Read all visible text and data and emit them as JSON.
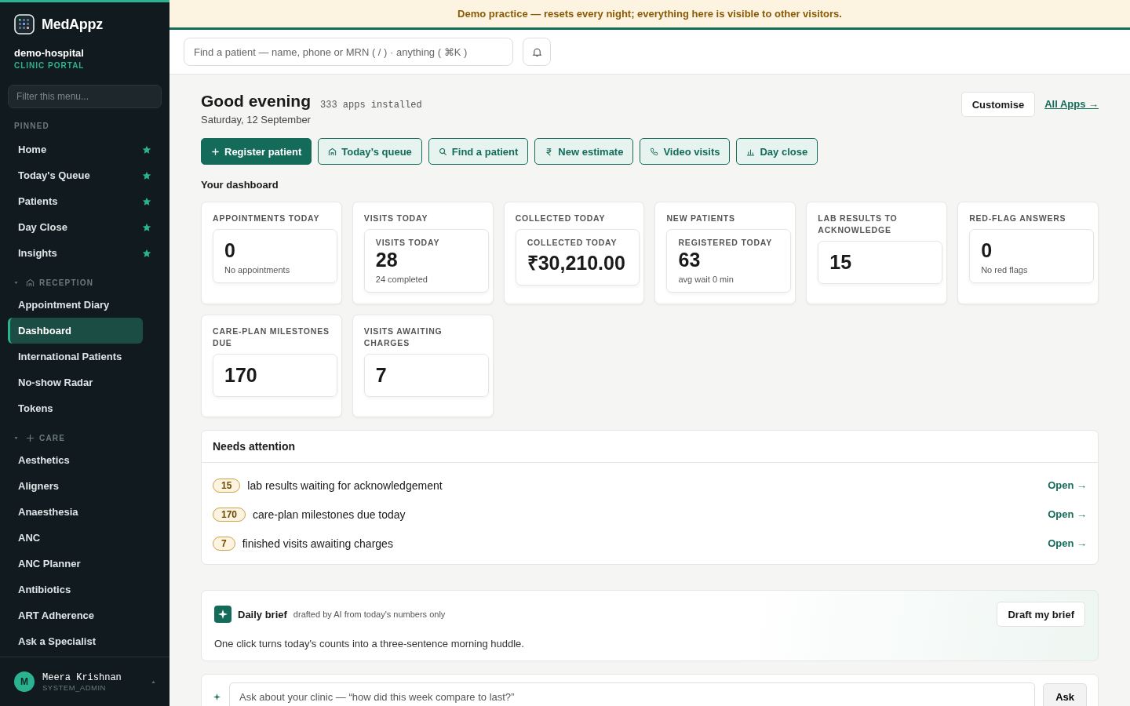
{
  "brand": {
    "name": "MedAppz",
    "org": "demo-hospital",
    "portal": "CLINIC PORTAL"
  },
  "sidebar": {
    "filter": {
      "placeholder": "Filter this menu..."
    },
    "pinned": {
      "title": "PINNED",
      "items": [
        {
          "label": "Home",
          "starred": true
        },
        {
          "label": "Today's Queue",
          "starred": true
        },
        {
          "label": "Patients",
          "starred": true
        },
        {
          "label": "Day Close",
          "starred": true
        },
        {
          "label": "Insights",
          "starred": true
        }
      ]
    },
    "sections": [
      {
        "title": "RECEPTION",
        "expanded": true,
        "items": [
          {
            "label": "Appointment Diary",
            "selected": false
          },
          {
            "label": "Dashboard",
            "selected": true
          },
          {
            "label": "International Patients",
            "selected": false
          },
          {
            "label": "No-show Radar",
            "selected": false
          },
          {
            "label": "Tokens",
            "selected": false
          }
        ]
      },
      {
        "title": "CARE",
        "expanded": true,
        "items": [
          {
            "label": "Aesthetics",
            "selected": false
          },
          {
            "label": "Aligners",
            "selected": false
          },
          {
            "label": "Anaesthesia",
            "selected": false
          },
          {
            "label": "ANC",
            "selected": false
          },
          {
            "label": "ANC Planner",
            "selected": false
          },
          {
            "label": "Antibiotics",
            "selected": false
          },
          {
            "label": "ART Adherence",
            "selected": false
          },
          {
            "label": "Ask a Specialist",
            "selected": false
          }
        ]
      }
    ],
    "user": {
      "initial": "M",
      "name": "Meera Krishnan",
      "role": "SYSTEM_ADMIN"
    }
  },
  "banner": "Demo practice — resets every night; everything here is visible to other visitors.",
  "search": {
    "placeholder": "Find a patient — name, phone or MRN ( / ) · anything ( ⌘K )"
  },
  "header": {
    "greeting": "Good evening",
    "date": "Saturday, 12 September",
    "apps": "333 apps installed",
    "customise": "Customise",
    "all_apps": "All Apps →"
  },
  "actions": [
    {
      "label": "Register patient",
      "kind": "primary"
    },
    {
      "label": "Today’s queue",
      "kind": "outline"
    },
    {
      "label": "Find a patient",
      "kind": "outline"
    },
    {
      "label": "New estimate",
      "kind": "outline"
    },
    {
      "label": "Video visits",
      "kind": "outline"
    },
    {
      "label": "Day close",
      "kind": "outline"
    }
  ],
  "dashboard": {
    "title": "Your dashboard",
    "widgets": [
      {
        "title": "APPOINTMENTS TODAY",
        "value": "0",
        "sub": "No appointments"
      },
      {
        "title": "VISITS TODAY",
        "label": "VISITS TODAY",
        "value": "28",
        "sub": "24 completed"
      },
      {
        "title": "COLLECTED TODAY",
        "label": "COLLECTED TODAY",
        "value": "₹30,210.00"
      },
      {
        "title": "NEW PATIENTS",
        "label": "REGISTERED TODAY",
        "value": "63",
        "sub": "avg wait 0 min"
      },
      {
        "title": "LAB RESULTS TO ACKNOWLEDGE",
        "value": "15"
      },
      {
        "title": "RED-FLAG ANSWERS",
        "value": "0",
        "sub": "No red flags"
      },
      {
        "title": "CARE-PLAN MILESTONES DUE",
        "value": "170"
      },
      {
        "title": "VISITS AWAITING CHARGES",
        "value": "7"
      }
    ]
  },
  "attention": {
    "title": "Needs attention",
    "items": [
      {
        "count": "15",
        "text": "lab results waiting for acknowledgement",
        "link": "Open →"
      },
      {
        "count": "170",
        "text": "care-plan milestones due today",
        "link": "Open →"
      },
      {
        "count": "7",
        "text": "finished visits awaiting charges",
        "link": "Open →"
      }
    ]
  },
  "brief": {
    "title": "Daily brief",
    "note": "drafted by AI from today's numbers only",
    "button": "Draft my brief",
    "text": "One click turns today's counts into a three-sentence morning huddle."
  },
  "ask": {
    "placeholder": "Ask about your clinic — “how did this week compare to last?”",
    "button": "Ask"
  }
}
